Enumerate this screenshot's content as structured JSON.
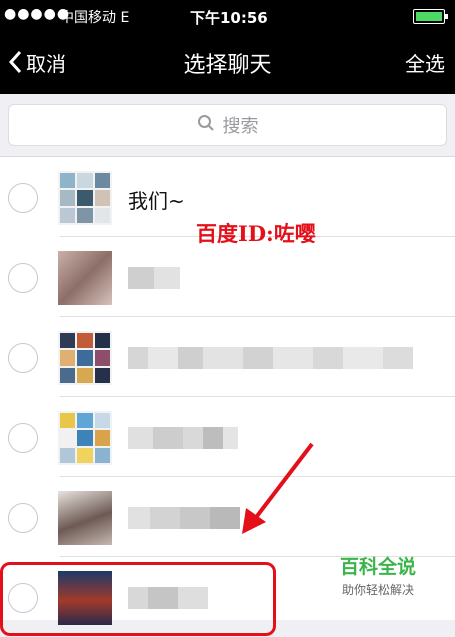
{
  "status_bar": {
    "signal": "●●●●●",
    "carrier": "中国移动  E",
    "time": "下午10:56"
  },
  "nav": {
    "back_label": "取消",
    "title": "选择聊天",
    "select_all": "全选"
  },
  "search": {
    "placeholder": "搜索"
  },
  "chats": [
    {
      "name": "我们~",
      "blurred": false
    },
    {
      "name": "",
      "blurred": true
    },
    {
      "name": "",
      "blurred": true
    },
    {
      "name": "",
      "blurred": true
    },
    {
      "name": "",
      "blurred": true
    },
    {
      "name": "",
      "blurred": true
    }
  ],
  "watermark": "百度ID:咗嘤",
  "logo": {
    "title": "百科全说",
    "subtitle": "助你轻松解决"
  },
  "colors": {
    "accent_red": "#e3101a",
    "logo_green": "#3bb54a",
    "battery_green": "#4cd964"
  }
}
